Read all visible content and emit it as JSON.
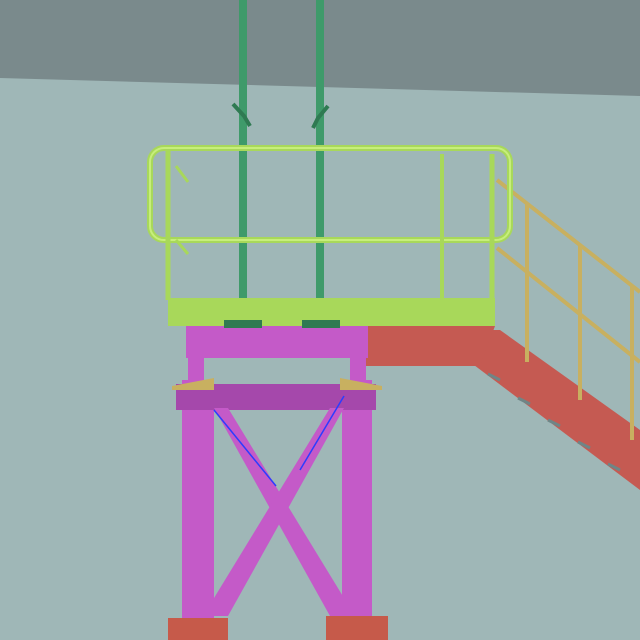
{
  "scene": {
    "colors": {
      "ceiling": "#7a8a8c",
      "wall": "#9fb7b7",
      "frame": "#c45ac8",
      "frame_shade": "#a548ab",
      "deck": "#c55a52",
      "railing": "#a8d85a",
      "railing_light": "#c7ee7c",
      "pipe": "#3f9a6a",
      "pipe_dark": "#2f7a52",
      "stair_rail": "#c8b060",
      "base_plate": "#c65a4a",
      "brace_edge": "#2c3cff"
    }
  }
}
